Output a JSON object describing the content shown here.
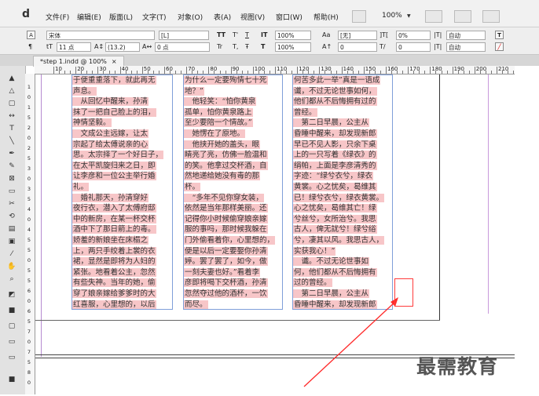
{
  "app": {
    "logo": "d"
  },
  "menu": [
    "文件(F)",
    "编辑(E)",
    "版面(L)",
    "文字(T)",
    "对象(O)",
    "表(A)",
    "视图(V)",
    "窗口(W)",
    "帮助(H)"
  ],
  "menubar_zoom": "100%",
  "control": {
    "font_family": "宋体",
    "font_style": "[L]",
    "font_size": "11 点",
    "leading": "(13.2)",
    "tracking": "0 点",
    "scale_v": "100%",
    "scale_h": "100%",
    "language": "[无]",
    "shade": "0",
    "lang2": "0%",
    "auto1": "自动",
    "auto2": "自动",
    "baseline": "0",
    "skew": "0",
    "tt": "TT",
    "tr": "Tr"
  },
  "tab": {
    "title": "*step 1.indd @ 100%",
    "close": "×"
  },
  "ruler": {
    "top": [
      "10",
      "20",
      "30",
      "40",
      "50",
      "60",
      "70",
      "80",
      "90",
      "100",
      "110",
      "120",
      "130",
      "140",
      "150",
      "160",
      "170",
      "180",
      "190",
      "200",
      "210"
    ],
    "left": [
      "1",
      "0",
      "1",
      "5",
      "2",
      "0",
      "2",
      "5",
      "3",
      "0",
      "3",
      "5",
      "4",
      "0",
      "4",
      "5",
      "5",
      "0",
      "5",
      "5",
      "6",
      "0",
      "6",
      "5",
      "7",
      "0",
      "7",
      "5",
      "8",
      "0"
    ]
  },
  "frames": {
    "col1": [
      "于便重重落下，就此再无",
      "声息。",
      "　从回忆中醒来，孙清",
      "抹了一把自己脸上的泪，",
      "神情坚毅。",
      "　文成公主远嫁，让太",
      "宗起了给太傅说亲的心",
      "思。太宗择了一个好日子，",
      "在太平凯旋归来之日，即",
      "让李彦和一位公主举行婚",
      "礼。",
      "　婚礼那天，孙清穿好",
      "夜行衣，潜入了太傅府邸",
      "中的新房，在某一杯交杯",
      "酒中下了那日箭上的毒。",
      "娇羞的新娘坐在床榻之",
      "上，两只手绞着上裳的衣",
      "裙，显然是即将为人妇的",
      "紧张。地看着公主，忽然",
      "有些失神。当年的她，偷",
      "穿了娘亲嫁给爹爹时的大",
      "红喜服，心里想的，以后"
    ],
    "col2": [
      "为什么一定要殉情七十死",
      "地？”",
      "　他轻笑：“怕你黄泉",
      "孤单，怕你黄泉路上",
      "至少要陪一个情故。”",
      "　她愣在了原地。",
      "　他挟开她的盖头，眼",
      "睛亮了亮，仿佛一脸温和",
      "的笑。他拿过交杯酒，自",
      "然地递给她没有毒的那",
      "杯。",
      "　“多年不见你穿女装，",
      "依然是当年那样美丽。还",
      "记得你小时候偷穿娘亲嫁",
      "服的事吗，那时候我躲在",
      "门外偷看着你，心里想的，",
      "便是以后一定要娶你孙清",
      "婷。罢了罢了，如今，做",
      "一刻夫妻也好。”看着李",
      "彦即将喝下交杯酒，孙清",
      "忽然夺过他的酒杯，一饮",
      "而尽。"
    ],
    "col3": [
      "何苦多此一举”真是一语成",
      "谶，不过无论世事如何，",
      "他们都从不后悔拥有过的",
      "曾经。",
      "　第二日早晨，公主从",
      "昏睡中醒来，却发现新郎",
      "早已不见人影，只余下桌",
      "上的一只写着《绿衣》的",
      "绢帕，上面是李彦清秀的",
      "字迹：“绿兮衣兮，绿衣",
      "黄裳。心之忧矣，曷维其",
      "已！绿兮衣兮，绿衣黄裳。",
      "心之忧矣，曷维其亡！绿",
      "兮丝兮，女所治兮。我思",
      "古人，俾无訧兮！绿兮绤",
      "兮，凄其以风。我思古人，",
      "实获我心！”",
      "　谶。不过无论世事如",
      "何，他们都从不后悔拥有",
      "过的曾经。",
      "　第二日早晨，公主从",
      "昏睡中醒来，却发现新郎"
    ]
  },
  "watermark": "最需教育"
}
